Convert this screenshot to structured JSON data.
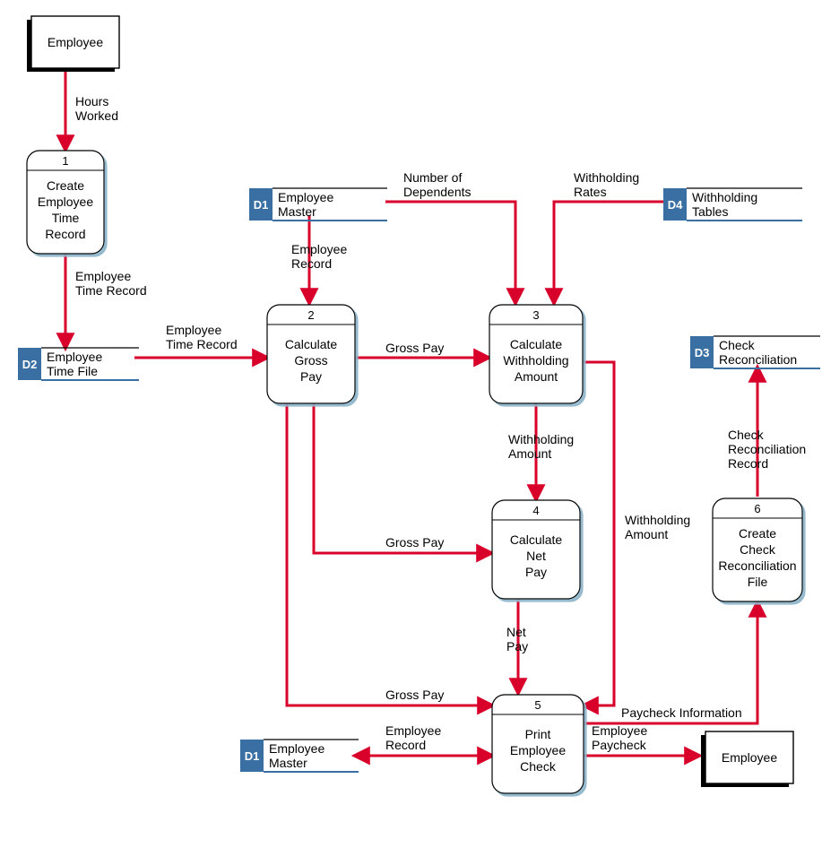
{
  "entities": {
    "employee_top": "Employee",
    "employee_bottom": "Employee"
  },
  "processes": {
    "p1": {
      "num": "1",
      "l1": "Create",
      "l2": "Employee",
      "l3": "Time",
      "l4": "Record"
    },
    "p2": {
      "num": "2",
      "l1": "Calculate",
      "l2": "Gross",
      "l3": "Pay"
    },
    "p3": {
      "num": "3",
      "l1": "Calculate",
      "l2": "Withholding",
      "l3": "Amount"
    },
    "p4": {
      "num": "4",
      "l1": "Calculate",
      "l2": "Net",
      "l3": "Pay"
    },
    "p5": {
      "num": "5",
      "l1": "Print",
      "l2": "Employee",
      "l3": "Check"
    },
    "p6": {
      "num": "6",
      "l1": "Create",
      "l2": "Check",
      "l3": "Reconciliation",
      "l4": "File"
    }
  },
  "datastores": {
    "d1a": {
      "id": "D1",
      "l1": "Employee",
      "l2": "Master"
    },
    "d2": {
      "id": "D2",
      "l1": "Employee",
      "l2": "Time File"
    },
    "d4": {
      "id": "D4",
      "l1": "Withholding",
      "l2": "Tables"
    },
    "d3": {
      "id": "D3",
      "l1": "Check",
      "l2": "Reconciliation"
    },
    "d1b": {
      "id": "D1",
      "l1": "Employee",
      "l2": "Master"
    }
  },
  "flows": {
    "hours_worked_l1": "Hours",
    "hours_worked_l2": "Worked",
    "etr_l1": "Employee",
    "etr_l2": "Time Record",
    "etr2_l1": "Employee",
    "etr2_l2": "Time Record",
    "emp_record_l1": "Employee",
    "emp_record_l2": "Record",
    "num_dep_l1": "Number of",
    "num_dep_l2": "Dependents",
    "with_rates_l1": "Withholding",
    "with_rates_l2": "Rates",
    "gross_pay_23": "Gross Pay",
    "with_amt_l1": "Withholding",
    "with_amt_l2": "Amount",
    "gross_pay_24": "Gross Pay",
    "net_pay_l1": "Net",
    "net_pay_l2": "Pay",
    "with_amt2_l1": "Withholding",
    "with_amt2_l2": "Amount",
    "gross_pay_25": "Gross Pay",
    "emp_record2_l1": "Employee",
    "emp_record2_l2": "Record",
    "emp_paycheck_l1": "Employee",
    "emp_paycheck_l2": "Paycheck",
    "paycheck_info": "Paycheck Information",
    "check_rec_l1": "Check",
    "check_rec_l2": "Reconciliation",
    "check_rec_l3": "Record"
  }
}
